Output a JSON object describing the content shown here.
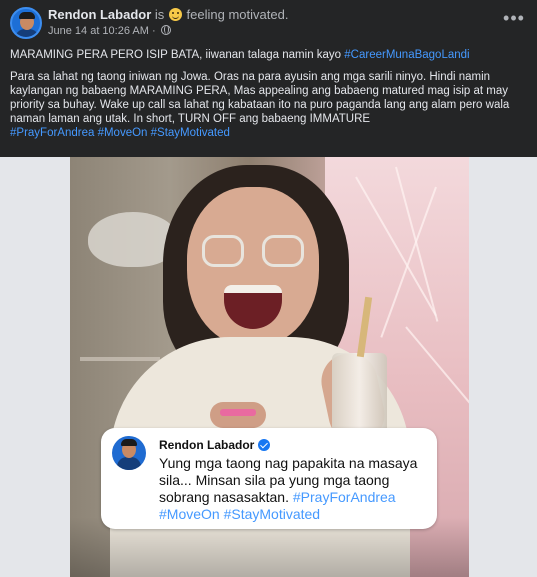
{
  "post": {
    "author": "Rendon Labador",
    "feeling_prefix": "is",
    "feeling_text": "feeling motivated.",
    "date": "June 14 at 10:26 AM",
    "separator": "·",
    "privacy_icon": "globe-icon",
    "more_label": "•••",
    "headline_text": "MARAMING PERA PERO ISIP BATA, iiwanan talaga namin kayo ",
    "headline_hashtag": "#CareerMunaBagoLandi",
    "body_text": "Para sa lahat ng taong iniwan ng Jowa. Oras na para ayusin ang mga sarili ninyo. Hindi namin kaylangan ng babaeng MARAMING PERA, Mas appealing ang babaeng matured mag isip at may priority sa buhay. Wake up call sa lahat ng kabataan ito na puro paganda lang ang alam pero wala naman laman ang utak. In short, TURN OFF ang babaeng IMMATURE",
    "body_hashtags": [
      "#PrayForAndrea",
      "#MoveOn",
      "#StayMotivated"
    ]
  },
  "image_card": {
    "name": "Rendon Labador",
    "verified_icon": "verified-badge-icon",
    "text": "Yung mga taong nag papakita na masaya sila... Minsan sila pa yung mga taong sobrang nasasaktan. ",
    "hashtags": [
      "#PrayForAndrea",
      "#MoveOn",
      "#StayMotivated"
    ]
  },
  "colors": {
    "background": "#242526",
    "hashtag": "#4599ff",
    "verified": "#1877f2"
  }
}
